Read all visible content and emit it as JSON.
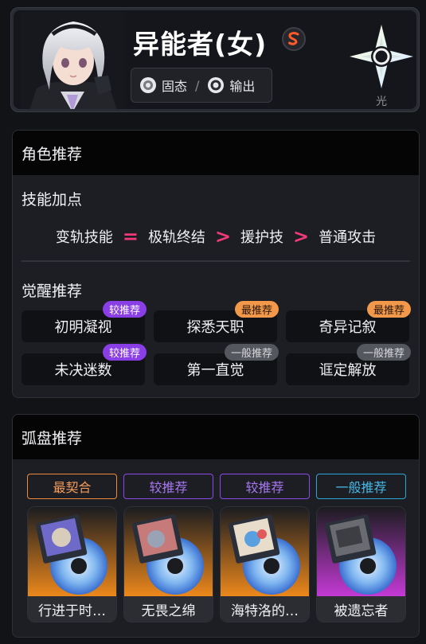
{
  "header": {
    "name": "异能者(女)",
    "rank_icon": "s-rank-icon",
    "tags": [
      {
        "icon": "gear-icon",
        "label": "固态"
      },
      {
        "icon": "ring-icon",
        "label": "输出"
      }
    ],
    "tag_separator": "/",
    "attribute": {
      "icon": "star-compass-icon",
      "label": "光"
    }
  },
  "character": {
    "section_title": "角色推荐",
    "skills": {
      "title": "技能加点",
      "order": [
        "变轨技能",
        "=",
        "极轨终结",
        ">",
        "援护技",
        ">",
        "普通攻击"
      ]
    },
    "awakening": {
      "title": "觉醒推荐",
      "items": [
        {
          "label": "初明凝视",
          "badge": "较推荐"
        },
        {
          "label": "探悉天职",
          "badge": "最推荐"
        },
        {
          "label": "奇异记叙",
          "badge": "最推荐"
        },
        {
          "label": "未决迷数",
          "badge": "较推荐"
        },
        {
          "label": "第一直觉",
          "badge": "一般推荐"
        },
        {
          "label": "诓定解放",
          "badge": "一般推荐"
        }
      ]
    }
  },
  "discs": {
    "section_title": "弧盘推荐",
    "items": [
      {
        "tier": "最契合",
        "name": "行进于时…"
      },
      {
        "tier": "较推荐",
        "name": "无畏之绵"
      },
      {
        "tier": "较推荐",
        "name": "海特洛的…"
      },
      {
        "tier": "一般推荐",
        "name": "被遗忘者"
      }
    ]
  },
  "colors": {
    "accent_pink": "#f23a78",
    "badge_purple": "#8a3ee6",
    "badge_orange": "#f2984a",
    "badge_gray": "#55575e",
    "tier_orange": "#f08a3a",
    "tier_purple": "#8a4ae8",
    "tier_cyan": "#2aa6d8"
  }
}
